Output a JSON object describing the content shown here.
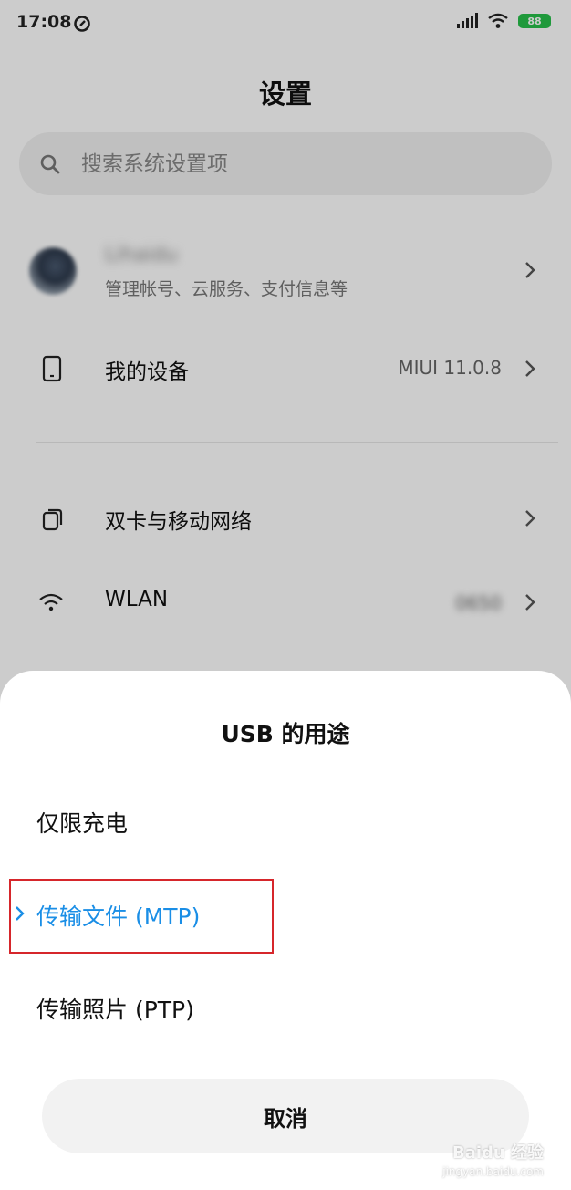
{
  "status_bar": {
    "time": "17:08",
    "battery": "88"
  },
  "settings": {
    "title": "设置",
    "search": {
      "placeholder": "搜索系统设置项"
    },
    "account": {
      "name": "Lihaidu",
      "subtitle": "管理帐号、云服务、支付信息等"
    },
    "items": [
      {
        "label": "我的设备",
        "value": "MIUI 11.0.8",
        "icon": "phone-icon"
      },
      {
        "label": "双卡与移动网络",
        "value": "",
        "icon": "sim-cards-icon"
      },
      {
        "label": "WLAN",
        "value": "0650",
        "icon": "wifi-icon"
      }
    ]
  },
  "usb_sheet": {
    "title": "USB 的用途",
    "options": [
      {
        "label": "仅限充电",
        "selected": false
      },
      {
        "label": "传输文件 (MTP)",
        "selected": true
      },
      {
        "label": "传输照片 (PTP)",
        "selected": false
      }
    ],
    "cancel_label": "取消"
  },
  "watermark": {
    "brand": "Baidu 经验",
    "site": "jingyan.baidu.com"
  },
  "colors": {
    "accent": "#1a8ee6",
    "highlight_border": "#d6262b",
    "battery": "#27c04a",
    "overlay": "rgba(0,0,0,0.20)"
  }
}
